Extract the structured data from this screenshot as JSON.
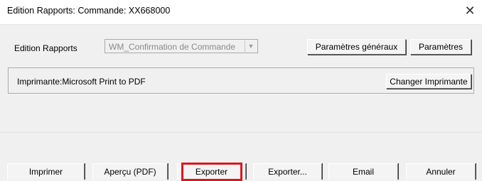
{
  "window": {
    "title": "Edition Rapports: Commande: XX668000",
    "close_glyph": "✕"
  },
  "report": {
    "label": "Edition Rapports",
    "selected": "WM_Confirmation de Commande",
    "dropdown_icon": "chevron-down-icon"
  },
  "toolbar": {
    "general_params": "Paramètres généraux",
    "params": "Paramètres"
  },
  "printer": {
    "text": "Imprimante:Microsoft Print to PDF",
    "change_button": "Changer Imprimante"
  },
  "actions": {
    "print": "Imprimer",
    "preview_pdf": "Aperçu (PDF)",
    "export": "Exporter",
    "export_more": "Exporter...",
    "email": "Email",
    "cancel": "Annuler"
  },
  "colors": {
    "highlight": "#e0141e",
    "window_bg": "#f0f0f0"
  }
}
